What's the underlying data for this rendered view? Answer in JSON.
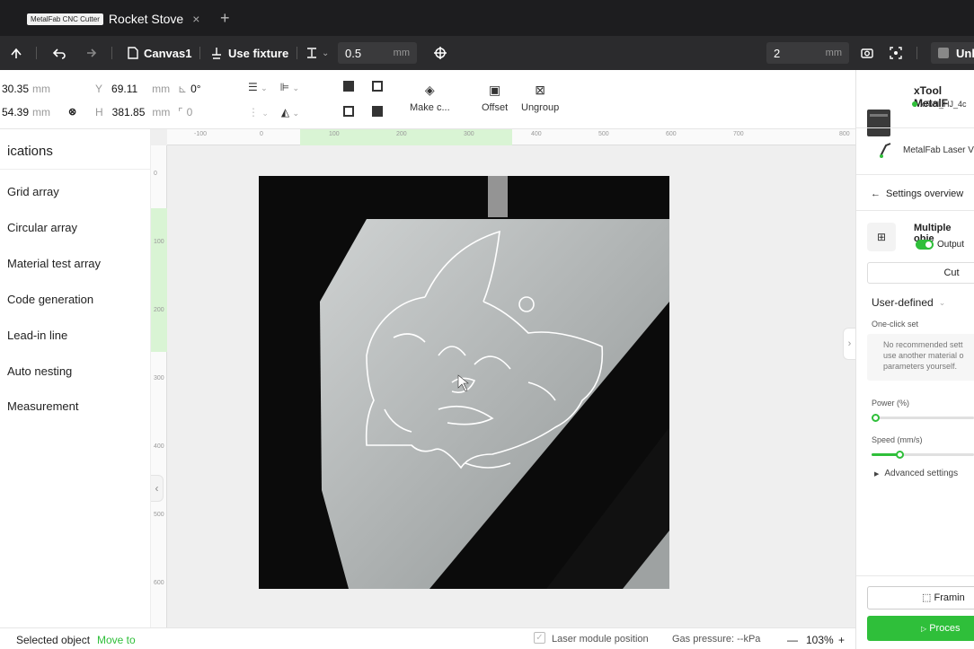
{
  "tabs": {
    "app_badge": "MetalFab CNC Cutter",
    "active_tab": "Rocket Stove",
    "close": "×",
    "new_tab": "+"
  },
  "toolbar": {
    "canvas_label": "Canvas1",
    "fixture_label": "Use fixture",
    "thickness_value": "0.5",
    "thickness_unit": "mm",
    "right_value": "2",
    "right_unit": "mm",
    "unit_button": "Unl"
  },
  "props": {
    "x_value": "30.35",
    "y_label": "Y",
    "y_value": "69.11",
    "rotate_value": "0°",
    "w_value": "54.39",
    "h_label": "H",
    "h_value": "381.85",
    "corner_value": "0",
    "unit": "mm",
    "make_label": "Make c...",
    "offset_label": "Offset",
    "ungroup_label": "Ungroup"
  },
  "sidebar": {
    "title": "ications",
    "items": [
      "Grid array",
      "Circular array",
      "Material test array",
      "Code generation",
      "Lead-in line",
      "Auto nesting",
      "Measurement"
    ]
  },
  "ruler": {
    "top_ticks": [
      "-100",
      "0",
      "100",
      "200",
      "300",
      "400",
      "500",
      "600",
      "700",
      "800"
    ],
    "left_ticks": [
      "0",
      "100",
      "200",
      "300",
      "400",
      "500",
      "600"
    ]
  },
  "statusbar": {
    "selected_label": "Selected object",
    "move_to": "Move to",
    "laser_position": "Laser module position",
    "gas_pressure": "Gas pressure: --kPa",
    "zoom_minus": "—",
    "zoom": "103%",
    "zoom_plus": "+"
  },
  "right_panel": {
    "device_name": "xTool MetalF",
    "device_id": "xTool_HJ_4c",
    "module_name": "MetalFab Laser V",
    "settings_overview": "Settings overview",
    "multiple_objects": "Multiple obje",
    "output_label": "Output",
    "cut_tab": "Cut",
    "user_defined": "User-defined",
    "one_click_set": "One-click set",
    "no_recommended": "No recommended sett use another material o parameters yourself.",
    "power_label": "Power (%)",
    "power_value": 0,
    "speed_label": "Speed (mm/s)",
    "speed_value_fraction": 0.27,
    "advanced": "Advanced settings",
    "framing": "Framin",
    "process": "Proces"
  },
  "colors": {
    "accent": "#2fbf3a",
    "dark": "#2b2b2d"
  }
}
